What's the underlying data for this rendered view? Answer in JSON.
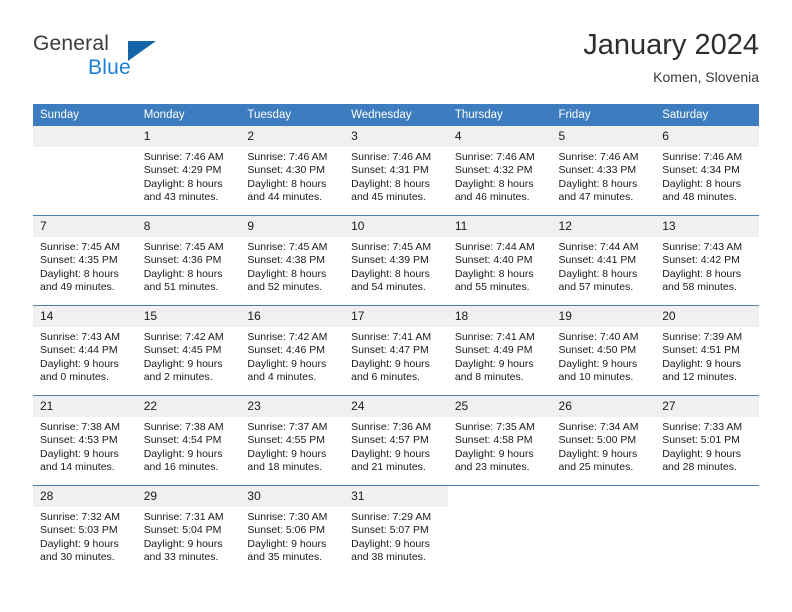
{
  "brand": {
    "name_part1": "General",
    "name_part2": "Blue",
    "triangle_color": "#1565a8",
    "blue_color": "#1b7fd4"
  },
  "header": {
    "title": "January 2024",
    "location": "Komen, Slovenia"
  },
  "theme": {
    "header_blue": "#3d7dbf",
    "week_divider": "#4a7fae",
    "daynum_bg": "#f0f0f0"
  },
  "weekdays": [
    "Sunday",
    "Monday",
    "Tuesday",
    "Wednesday",
    "Thursday",
    "Friday",
    "Saturday"
  ],
  "weeks": [
    [
      {
        "day": "",
        "sunrise": "",
        "sunset": "",
        "daylight_line1": "",
        "daylight_line2": "",
        "empty": true
      },
      {
        "day": "1",
        "sunrise": "Sunrise: 7:46 AM",
        "sunset": "Sunset: 4:29 PM",
        "daylight_line1": "Daylight: 8 hours",
        "daylight_line2": "and 43 minutes."
      },
      {
        "day": "2",
        "sunrise": "Sunrise: 7:46 AM",
        "sunset": "Sunset: 4:30 PM",
        "daylight_line1": "Daylight: 8 hours",
        "daylight_line2": "and 44 minutes."
      },
      {
        "day": "3",
        "sunrise": "Sunrise: 7:46 AM",
        "sunset": "Sunset: 4:31 PM",
        "daylight_line1": "Daylight: 8 hours",
        "daylight_line2": "and 45 minutes."
      },
      {
        "day": "4",
        "sunrise": "Sunrise: 7:46 AM",
        "sunset": "Sunset: 4:32 PM",
        "daylight_line1": "Daylight: 8 hours",
        "daylight_line2": "and 46 minutes."
      },
      {
        "day": "5",
        "sunrise": "Sunrise: 7:46 AM",
        "sunset": "Sunset: 4:33 PM",
        "daylight_line1": "Daylight: 8 hours",
        "daylight_line2": "and 47 minutes."
      },
      {
        "day": "6",
        "sunrise": "Sunrise: 7:46 AM",
        "sunset": "Sunset: 4:34 PM",
        "daylight_line1": "Daylight: 8 hours",
        "daylight_line2": "and 48 minutes."
      }
    ],
    [
      {
        "day": "7",
        "sunrise": "Sunrise: 7:45 AM",
        "sunset": "Sunset: 4:35 PM",
        "daylight_line1": "Daylight: 8 hours",
        "daylight_line2": "and 49 minutes."
      },
      {
        "day": "8",
        "sunrise": "Sunrise: 7:45 AM",
        "sunset": "Sunset: 4:36 PM",
        "daylight_line1": "Daylight: 8 hours",
        "daylight_line2": "and 51 minutes."
      },
      {
        "day": "9",
        "sunrise": "Sunrise: 7:45 AM",
        "sunset": "Sunset: 4:38 PM",
        "daylight_line1": "Daylight: 8 hours",
        "daylight_line2": "and 52 minutes."
      },
      {
        "day": "10",
        "sunrise": "Sunrise: 7:45 AM",
        "sunset": "Sunset: 4:39 PM",
        "daylight_line1": "Daylight: 8 hours",
        "daylight_line2": "and 54 minutes."
      },
      {
        "day": "11",
        "sunrise": "Sunrise: 7:44 AM",
        "sunset": "Sunset: 4:40 PM",
        "daylight_line1": "Daylight: 8 hours",
        "daylight_line2": "and 55 minutes."
      },
      {
        "day": "12",
        "sunrise": "Sunrise: 7:44 AM",
        "sunset": "Sunset: 4:41 PM",
        "daylight_line1": "Daylight: 8 hours",
        "daylight_line2": "and 57 minutes."
      },
      {
        "day": "13",
        "sunrise": "Sunrise: 7:43 AM",
        "sunset": "Sunset: 4:42 PM",
        "daylight_line1": "Daylight: 8 hours",
        "daylight_line2": "and 58 minutes."
      }
    ],
    [
      {
        "day": "14",
        "sunrise": "Sunrise: 7:43 AM",
        "sunset": "Sunset: 4:44 PM",
        "daylight_line1": "Daylight: 9 hours",
        "daylight_line2": "and 0 minutes."
      },
      {
        "day": "15",
        "sunrise": "Sunrise: 7:42 AM",
        "sunset": "Sunset: 4:45 PM",
        "daylight_line1": "Daylight: 9 hours",
        "daylight_line2": "and 2 minutes."
      },
      {
        "day": "16",
        "sunrise": "Sunrise: 7:42 AM",
        "sunset": "Sunset: 4:46 PM",
        "daylight_line1": "Daylight: 9 hours",
        "daylight_line2": "and 4 minutes."
      },
      {
        "day": "17",
        "sunrise": "Sunrise: 7:41 AM",
        "sunset": "Sunset: 4:47 PM",
        "daylight_line1": "Daylight: 9 hours",
        "daylight_line2": "and 6 minutes."
      },
      {
        "day": "18",
        "sunrise": "Sunrise: 7:41 AM",
        "sunset": "Sunset: 4:49 PM",
        "daylight_line1": "Daylight: 9 hours",
        "daylight_line2": "and 8 minutes."
      },
      {
        "day": "19",
        "sunrise": "Sunrise: 7:40 AM",
        "sunset": "Sunset: 4:50 PM",
        "daylight_line1": "Daylight: 9 hours",
        "daylight_line2": "and 10 minutes."
      },
      {
        "day": "20",
        "sunrise": "Sunrise: 7:39 AM",
        "sunset": "Sunset: 4:51 PM",
        "daylight_line1": "Daylight: 9 hours",
        "daylight_line2": "and 12 minutes."
      }
    ],
    [
      {
        "day": "21",
        "sunrise": "Sunrise: 7:38 AM",
        "sunset": "Sunset: 4:53 PM",
        "daylight_line1": "Daylight: 9 hours",
        "daylight_line2": "and 14 minutes."
      },
      {
        "day": "22",
        "sunrise": "Sunrise: 7:38 AM",
        "sunset": "Sunset: 4:54 PM",
        "daylight_line1": "Daylight: 9 hours",
        "daylight_line2": "and 16 minutes."
      },
      {
        "day": "23",
        "sunrise": "Sunrise: 7:37 AM",
        "sunset": "Sunset: 4:55 PM",
        "daylight_line1": "Daylight: 9 hours",
        "daylight_line2": "and 18 minutes."
      },
      {
        "day": "24",
        "sunrise": "Sunrise: 7:36 AM",
        "sunset": "Sunset: 4:57 PM",
        "daylight_line1": "Daylight: 9 hours",
        "daylight_line2": "and 21 minutes."
      },
      {
        "day": "25",
        "sunrise": "Sunrise: 7:35 AM",
        "sunset": "Sunset: 4:58 PM",
        "daylight_line1": "Daylight: 9 hours",
        "daylight_line2": "and 23 minutes."
      },
      {
        "day": "26",
        "sunrise": "Sunrise: 7:34 AM",
        "sunset": "Sunset: 5:00 PM",
        "daylight_line1": "Daylight: 9 hours",
        "daylight_line2": "and 25 minutes."
      },
      {
        "day": "27",
        "sunrise": "Sunrise: 7:33 AM",
        "sunset": "Sunset: 5:01 PM",
        "daylight_line1": "Daylight: 9 hours",
        "daylight_line2": "and 28 minutes."
      }
    ],
    [
      {
        "day": "28",
        "sunrise": "Sunrise: 7:32 AM",
        "sunset": "Sunset: 5:03 PM",
        "daylight_line1": "Daylight: 9 hours",
        "daylight_line2": "and 30 minutes."
      },
      {
        "day": "29",
        "sunrise": "Sunrise: 7:31 AM",
        "sunset": "Sunset: 5:04 PM",
        "daylight_line1": "Daylight: 9 hours",
        "daylight_line2": "and 33 minutes."
      },
      {
        "day": "30",
        "sunrise": "Sunrise: 7:30 AM",
        "sunset": "Sunset: 5:06 PM",
        "daylight_line1": "Daylight: 9 hours",
        "daylight_line2": "and 35 minutes."
      },
      {
        "day": "31",
        "sunrise": "Sunrise: 7:29 AM",
        "sunset": "Sunset: 5:07 PM",
        "daylight_line1": "Daylight: 9 hours",
        "daylight_line2": "and 38 minutes."
      },
      {
        "day": "",
        "sunrise": "",
        "sunset": "",
        "daylight_line1": "",
        "daylight_line2": "",
        "empty": true,
        "nofill": true
      },
      {
        "day": "",
        "sunrise": "",
        "sunset": "",
        "daylight_line1": "",
        "daylight_line2": "",
        "empty": true,
        "nofill": true
      },
      {
        "day": "",
        "sunrise": "",
        "sunset": "",
        "daylight_line1": "",
        "daylight_line2": "",
        "empty": true,
        "nofill": true
      }
    ]
  ]
}
